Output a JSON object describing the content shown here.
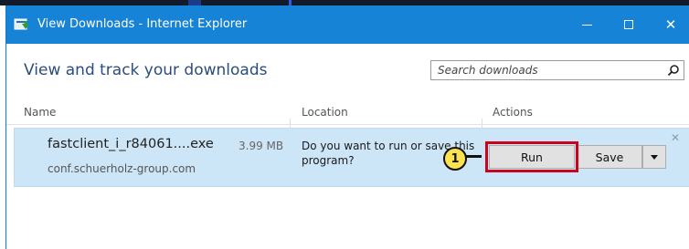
{
  "window": {
    "title": "View Downloads - Internet Explorer",
    "controls": {
      "minimize": "minimize",
      "maximize": "maximize",
      "close": "✕"
    }
  },
  "header": {
    "title": "View and track your downloads"
  },
  "search": {
    "placeholder": "Search downloads",
    "icon": "search-icon"
  },
  "columns": {
    "name": "Name",
    "location": "Location",
    "actions": "Actions"
  },
  "downloads": [
    {
      "file_name": "fastclient_i_r84061....exe",
      "size": "3.99 MB",
      "source": "conf.schuerholz-group.com",
      "prompt": "Do you want to run or save this program?",
      "run_label": "Run",
      "save_label": "Save",
      "dismiss": "✕"
    }
  ],
  "annotation": {
    "step_number": "1",
    "highlight_color": "#d0021b",
    "callout_color": "#fde24f"
  },
  "colors": {
    "titlebar": "#1683d7",
    "row_selected": "#cde6f7",
    "header_text": "#2a4d7d"
  }
}
